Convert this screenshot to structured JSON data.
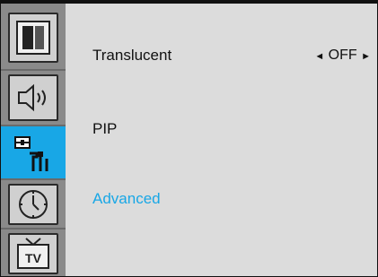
{
  "sidebar": {
    "items": [
      {
        "icon": "picture-icon",
        "selected": false
      },
      {
        "icon": "sound-icon",
        "selected": false
      },
      {
        "icon": "setup-tools-icon",
        "selected": true
      },
      {
        "icon": "clock-icon",
        "selected": false
      },
      {
        "icon": "tv-icon",
        "selected": false,
        "label": "TV"
      }
    ]
  },
  "menu": {
    "items": [
      {
        "label": "Translucent",
        "value": "OFF",
        "left_arrow": "◄",
        "right_arrow": "►"
      },
      {
        "label": "PIP"
      },
      {
        "label": "Advanced",
        "active": true
      }
    ]
  },
  "colors": {
    "accent": "#18a7e6",
    "panel": "#dcdcdc",
    "sidebar": "#8a8a8a"
  }
}
